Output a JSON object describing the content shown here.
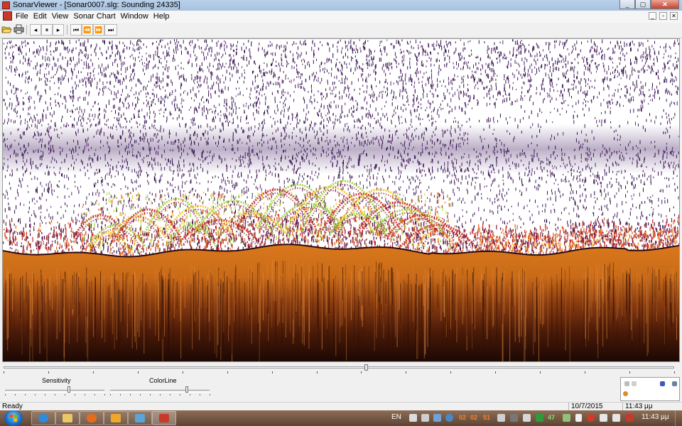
{
  "window": {
    "title": "SonarViewer - [Sonar0007.slg: Sounding 24335]",
    "controls": [
      "_",
      "▢",
      "✕"
    ]
  },
  "menubar": {
    "items": [
      "File",
      "Edit",
      "View",
      "Sonar Chart",
      "Window",
      "Help"
    ],
    "mdi_controls": [
      "_",
      "▫",
      "✕"
    ]
  },
  "toolbar": {
    "open_icon": "folder-open-icon",
    "print_icon": "printer-icon",
    "step_back": "◂",
    "pause": "⏸",
    "play": "▸",
    "skip_start": "⏮",
    "rewind": "⏪",
    "fast_forward": "⏩",
    "skip_end": "⏭"
  },
  "chart_data": {
    "type": "heatmap",
    "description_colors": {
      "surface_noise": "#3c1a5c",
      "fish_arches": [
        "#9acd32",
        "#f0c020",
        "#c8221a"
      ],
      "bottom_return": "#d8781e",
      "sub_bottom": "#3a1608"
    }
  },
  "position_slider": {
    "value_fraction": 0.54,
    "tick_count": 16
  },
  "controls": {
    "sensitivity_label": "Sensitivity",
    "sensitivity_value_fraction": 0.65,
    "colorline_label": "ColorLine",
    "colorline_value_fraction": 0.78
  },
  "statusbar": {
    "status": "Ready",
    "date": "10/7/2015",
    "time": "11:43 μμ"
  },
  "taskbar": {
    "language": "EN",
    "tray_numbers": [
      "02",
      "02",
      "51",
      "47"
    ],
    "clock": "11:43 μμ"
  }
}
